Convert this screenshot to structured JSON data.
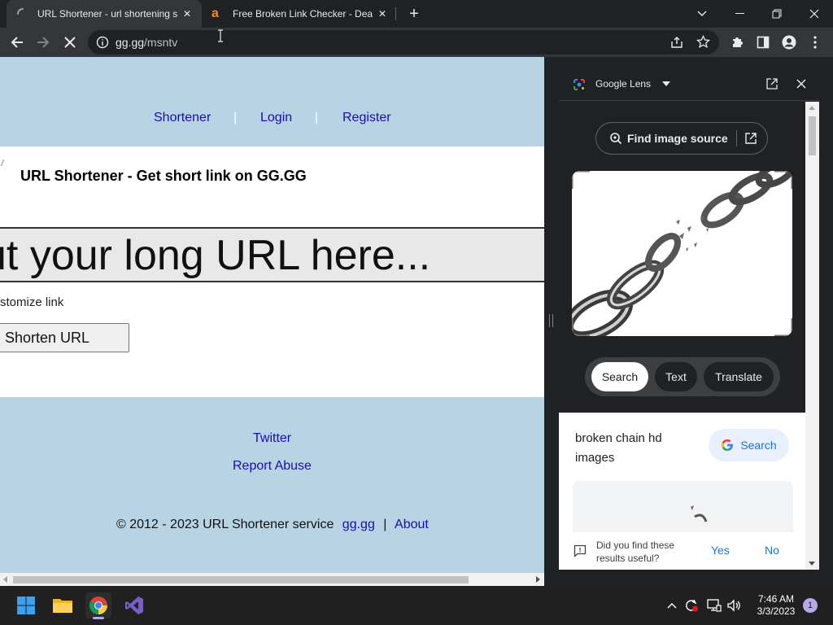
{
  "tabs": [
    {
      "title": "URL Shortener - url shortening se",
      "active": true,
      "icon": "loading-spinner-icon"
    },
    {
      "title": "Free Broken Link Checker - Dead",
      "active": false,
      "icon": "letter-a-favicon-icon"
    }
  ],
  "address_bar": {
    "host": "gg.gg",
    "path": "/msntv"
  },
  "page": {
    "nav": {
      "shortener": "Shortener",
      "login": "Login",
      "register": "Register",
      "separator": "|"
    },
    "site_title": "URL Shortener - Get short link on GG.GG",
    "url_input_placeholder": "ut your long URL here...",
    "customize_label": "stomize link",
    "shorten_button": "Shorten URL",
    "footer": {
      "twitter": "Twitter",
      "report_abuse": "Report Abuse",
      "copyright": "© 2012 - 2023 URL Shortener service",
      "ggg_link": "gg.gg",
      "separator": "|",
      "about": "About"
    }
  },
  "side_panel": {
    "title": "Google Lens",
    "find_image_source": "Find image source",
    "modes": [
      "Search",
      "Text",
      "Translate"
    ],
    "selected_mode": "Search",
    "result_text": "broken chain hd images",
    "google_search_button": "Search",
    "feedback_question": "Did you find these results useful?",
    "feedback_yes": "Yes",
    "feedback_no": "No"
  },
  "taskbar": {
    "time": "7:46 AM",
    "date": "3/3/2023",
    "notification_count": "1"
  },
  "colors": {
    "page_band": "#b8d4e4",
    "link": "#1a0dab",
    "chrome_dark": "#202124",
    "chrome_toolbar": "#35363a",
    "google_blue": "#1a73e8"
  }
}
